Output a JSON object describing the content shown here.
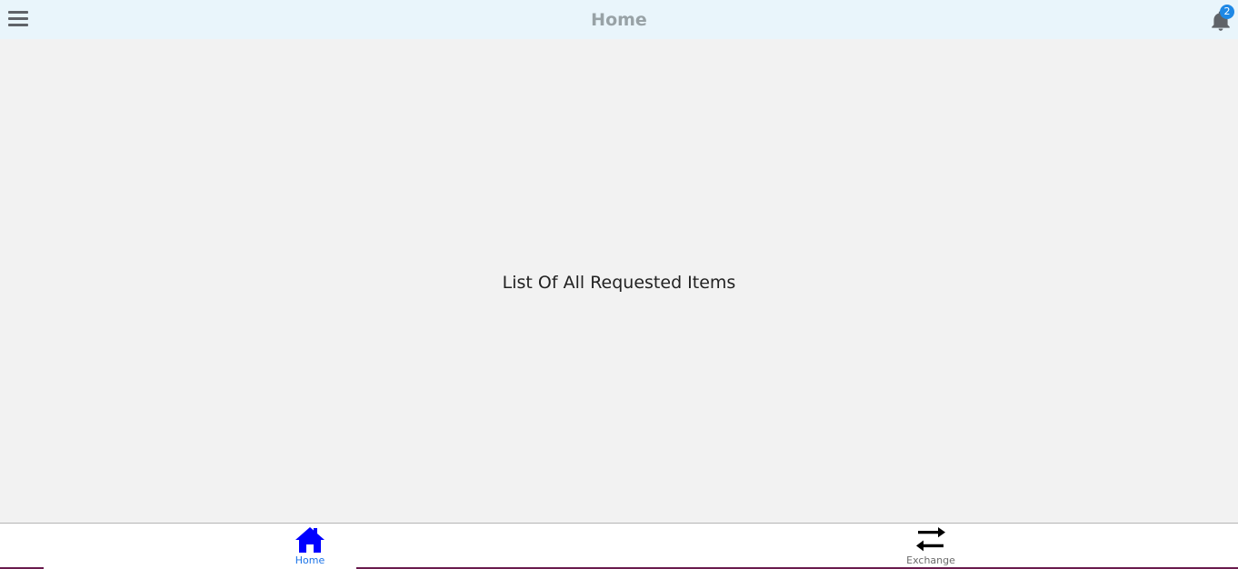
{
  "header": {
    "title": "Home",
    "menu_icon": "hamburger-menu-icon",
    "notification_icon": "bell-icon",
    "notification_count": "2",
    "background_color": "#e9f5fb"
  },
  "main": {
    "message": "List Of All Requested Items"
  },
  "tabbar": {
    "tabs": [
      {
        "label": "Home",
        "icon": "home-icon",
        "active": true,
        "color": "#0000ff"
      },
      {
        "label": "Exchange",
        "icon": "exchange-arrows-icon",
        "active": false,
        "color": "#000000"
      }
    ]
  }
}
